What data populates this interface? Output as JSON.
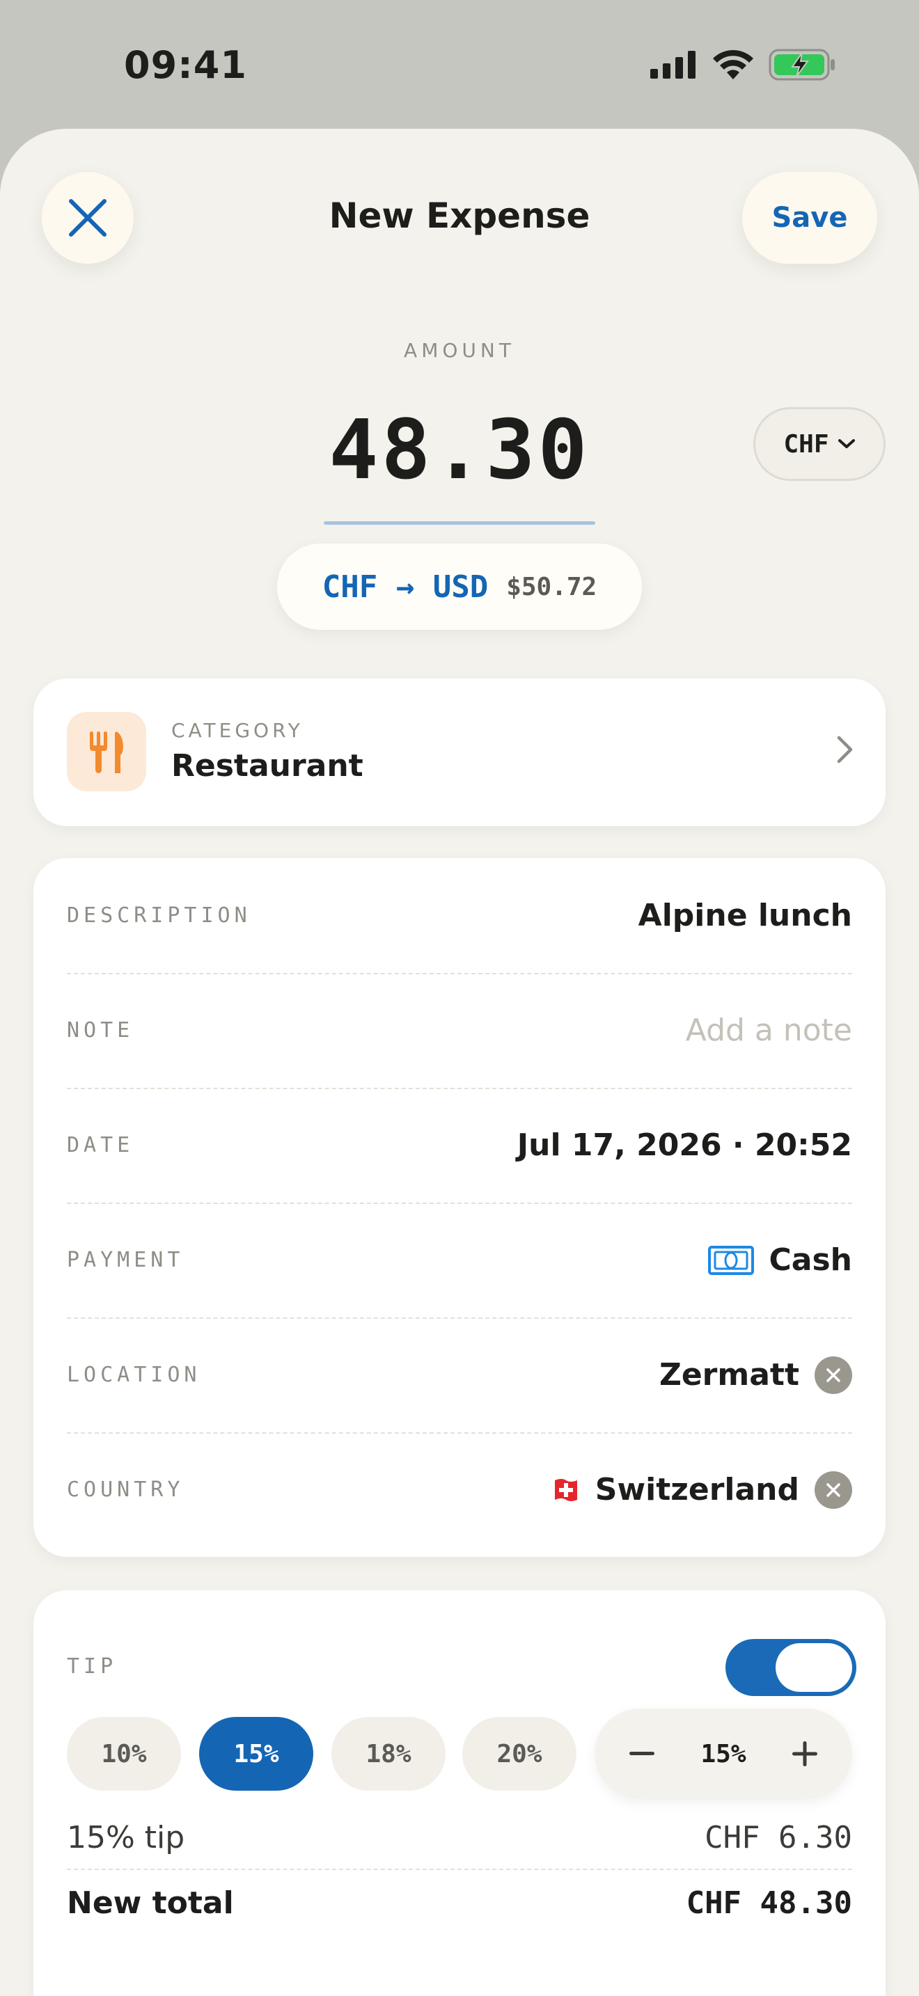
{
  "status_bar": {
    "time": "09:41"
  },
  "header": {
    "title": "New Expense",
    "save_label": "Save"
  },
  "amount": {
    "label": "AMOUNT",
    "value": "48.30",
    "currency": "CHF",
    "conversion_label": "CHF → USD",
    "conversion_value": "$50.72"
  },
  "category": {
    "label": "CATEGORY",
    "value": "Restaurant",
    "icon": "fork-knife-icon",
    "accent": "#f28a2e"
  },
  "details": {
    "description": {
      "label": "DESCRIPTION",
      "value": "Alpine lunch"
    },
    "note": {
      "label": "NOTE",
      "placeholder": "Add a note"
    },
    "date": {
      "label": "DATE",
      "value": "Jul 17, 2026 · 20:52"
    },
    "payment": {
      "label": "PAYMENT",
      "value": "Cash",
      "icon": "cash-icon"
    },
    "location": {
      "label": "LOCATION",
      "value": "Zermatt"
    },
    "country": {
      "label": "COUNTRY",
      "value": "Switzerland",
      "icon": "swiss-flag-icon"
    }
  },
  "tip": {
    "label": "TIP",
    "enabled": true,
    "chips": [
      "10%",
      "15%",
      "18%",
      "20%"
    ],
    "selected": "15%",
    "stepper_value": "15%",
    "tip_line_label": "15% tip",
    "tip_line_value": "CHF 6.30",
    "total_label": "New total",
    "total_value": "CHF 48.30"
  },
  "colors": {
    "accent": "#1565b5",
    "background": "#f4f2ec",
    "battery": "#34c759"
  }
}
